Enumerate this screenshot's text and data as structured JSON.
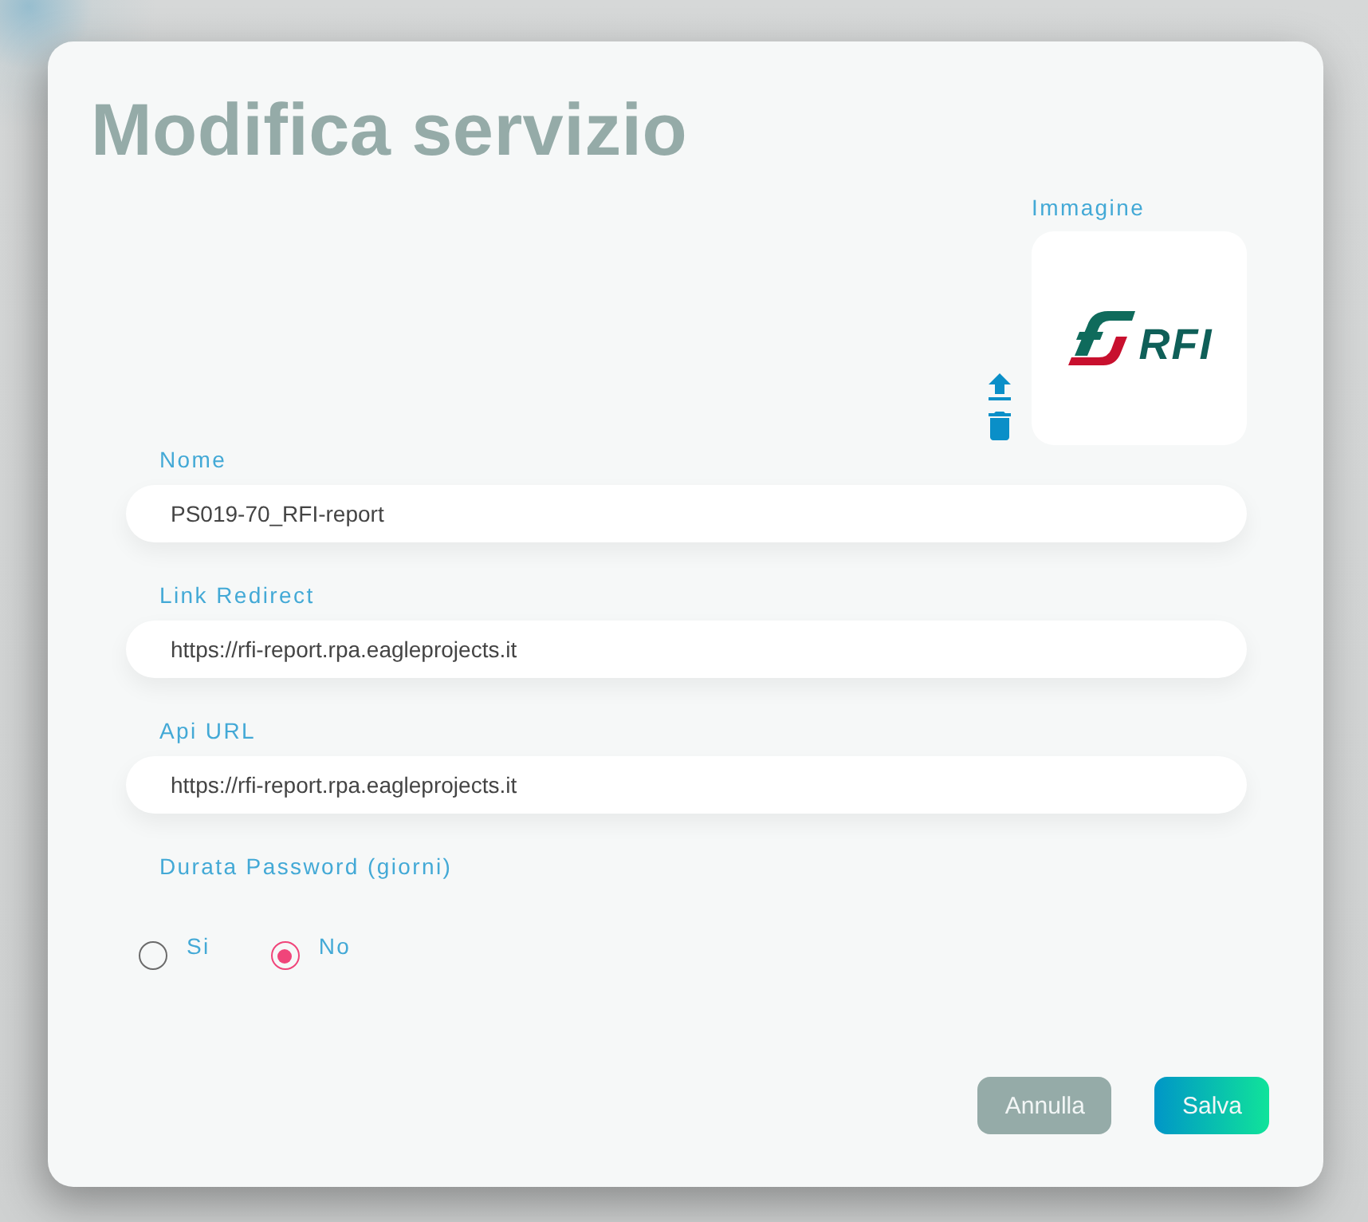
{
  "dialog": {
    "title": "Modifica servizio"
  },
  "image": {
    "label": "Immagine",
    "logo_text": "RFI"
  },
  "fields": [
    {
      "label": "Nome",
      "value": "PS019-70_RFI-report"
    },
    {
      "label": "Link Redirect",
      "value": "https://rfi-report.rpa.eagleprojects.it"
    },
    {
      "label": "Api URL",
      "value": "https://rfi-report.rpa.eagleprojects.it"
    }
  ],
  "password_duration": {
    "label": "Durata Password (giorni)",
    "options": [
      {
        "label": "Si",
        "selected": false
      },
      {
        "label": "No",
        "selected": true
      }
    ]
  },
  "buttons": [
    {
      "label": "Annulla",
      "kind": "secondary"
    },
    {
      "label": "Salva",
      "kind": "primary"
    }
  ]
}
